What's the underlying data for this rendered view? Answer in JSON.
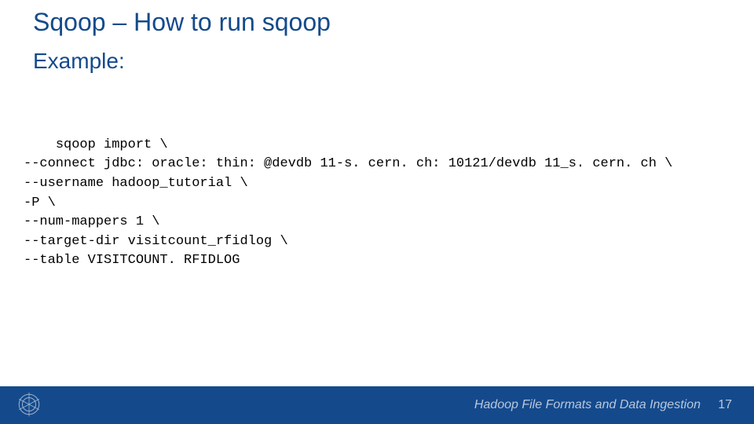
{
  "slide": {
    "title": "Sqoop – How to run sqoop",
    "subtitle": "Example:",
    "code_lines": [
      "sqoop import \\",
      "--connect jdbc: oracle: thin: @devdb 11-s. cern. ch: 10121/devdb 11_s. cern. ch \\",
      "--username hadoop_tutorial \\",
      "-P \\",
      "--num-mappers 1 \\",
      "--target-dir visitcount_rfidlog \\",
      "--table VISITCOUNT. RFIDLOG"
    ],
    "footer": {
      "doc_title": "Hadoop File Formats and Data Ingestion",
      "page_number": "17",
      "logo_alt": "cern-logo"
    }
  }
}
